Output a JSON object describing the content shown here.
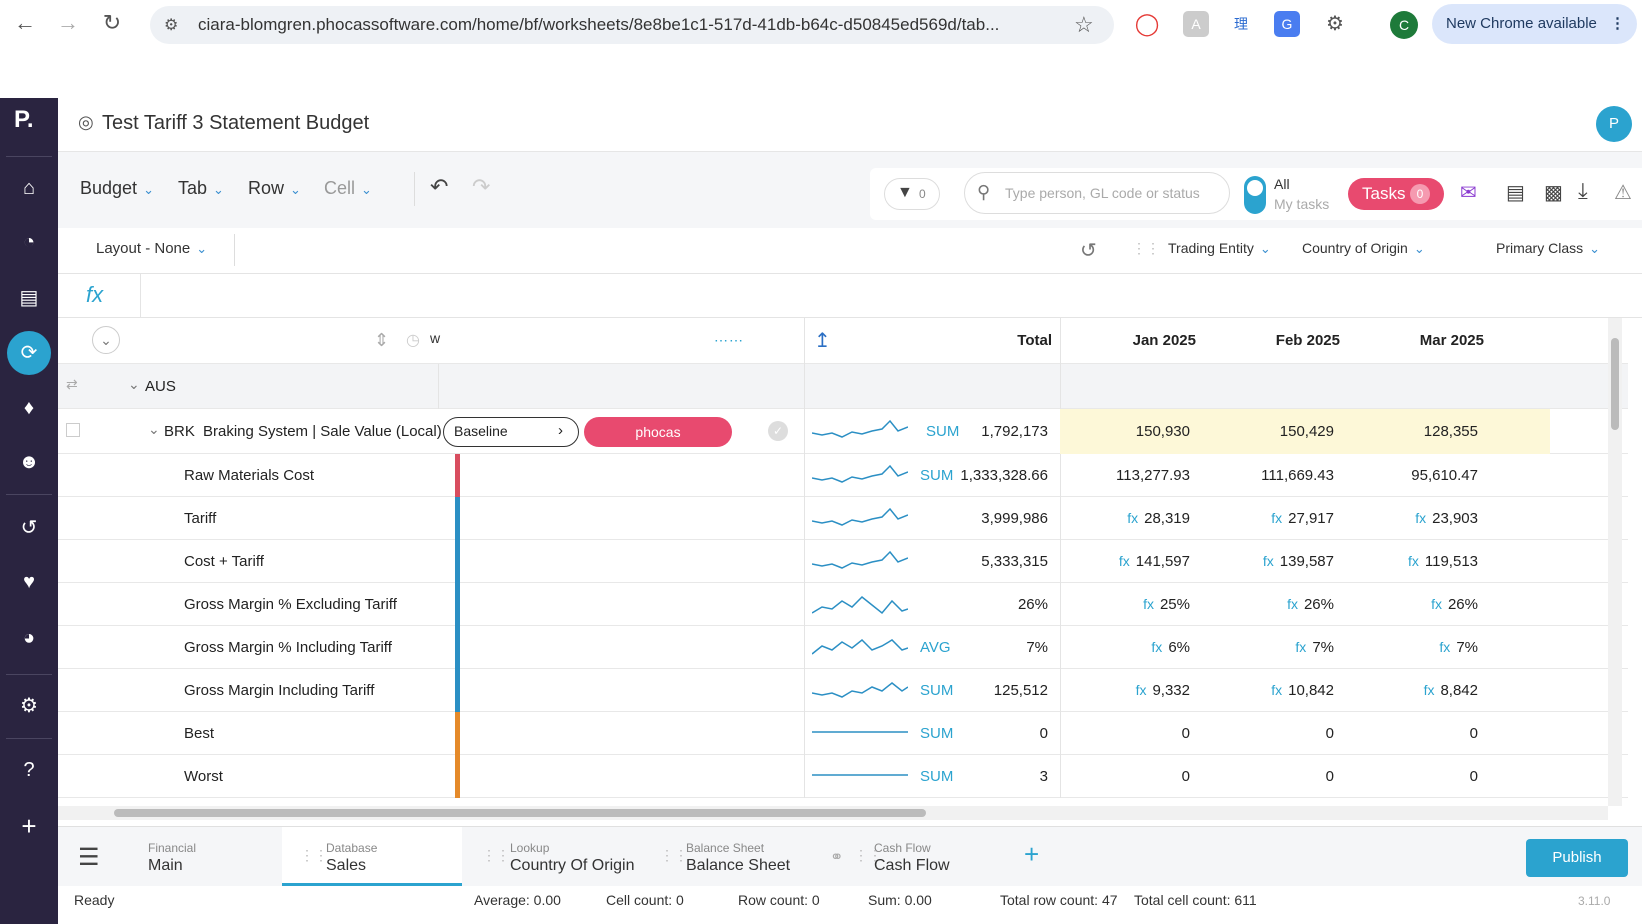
{
  "browser": {
    "url": "ciara-blomgren.phocassoftware.com/home/bf/worksheets/8e8be1c1-517d-41db-b64c-d50845ed569d/tab...",
    "new_chrome": "New Chrome available",
    "avatar_letter": "C"
  },
  "app": {
    "logo": "P.",
    "title": "Test Tariff 3 Statement Budget",
    "user_initial": "P"
  },
  "toolbar": {
    "menus": [
      "Budget",
      "Tab",
      "Row",
      "Cell"
    ],
    "filter_count": "0",
    "search_placeholder": "Type person, GL code or status",
    "all_label": "All",
    "my_tasks_label": "My tasks",
    "tasks_label": "Tasks",
    "tasks_count": "0"
  },
  "layout_bar": {
    "layout_label": "Layout - None",
    "dimensions": [
      "Trading Entity",
      "Country of Origin",
      "Primary Class"
    ]
  },
  "fx_label": "fx",
  "grid": {
    "header": {
      "col_total": "Total",
      "months": [
        "Jan 2025",
        "Feb 2025",
        "Mar 2025"
      ],
      "w": "w"
    },
    "group_label": "AUS",
    "main_row": {
      "code": "BRK",
      "label": "Braking System | Sale Value (Local)",
      "baseline": "Baseline",
      "tag": "phocas",
      "agg": "SUM",
      "total": "1,792,173",
      "months": [
        "150,930",
        "150,429",
        "128,355"
      ]
    },
    "rows": [
      {
        "label": "Raw Materials Cost",
        "agg": "SUM",
        "total": "1,333,328.66",
        "months": [
          "113,277.93",
          "111,669.43",
          "95,610.47"
        ],
        "fx": false
      },
      {
        "label": "Tariff",
        "agg": "",
        "total": "3,999,986",
        "months": [
          "28,319",
          "27,917",
          "23,903"
        ],
        "fx": true
      },
      {
        "label": "Cost + Tariff",
        "agg": "",
        "total": "5,333,315",
        "months": [
          "141,597",
          "139,587",
          "119,513"
        ],
        "fx": true
      },
      {
        "label": "Gross Margin % Excluding Tariff",
        "agg": "",
        "total": "26%",
        "months": [
          "25%",
          "26%",
          "26%"
        ],
        "fx": true
      },
      {
        "label": "Gross Margin % Including Tariff",
        "agg": "AVG",
        "total": "7%",
        "months": [
          "6%",
          "7%",
          "7%"
        ],
        "fx": true
      },
      {
        "label": "Gross Margin Including Tariff",
        "agg": "SUM",
        "total": "125,512",
        "months": [
          "9,332",
          "10,842",
          "8,842"
        ],
        "fx": true
      },
      {
        "label": "Best",
        "agg": "SUM",
        "total": "0",
        "months": [
          "0",
          "0",
          "0"
        ],
        "fx": false
      },
      {
        "label": "Worst",
        "agg": "SUM",
        "total": "3",
        "months": [
          "0",
          "0",
          "0"
        ],
        "fx": false
      }
    ],
    "fx_glyph": "fx"
  },
  "bottom_tabs": [
    {
      "small": "Financial",
      "big": "Main"
    },
    {
      "small": "Database",
      "big": "Sales"
    },
    {
      "small": "Lookup",
      "big": "Country Of Origin"
    },
    {
      "small": "Balance Sheet",
      "big": "Balance Sheet"
    },
    {
      "small": "Cash Flow",
      "big": "Cash Flow"
    }
  ],
  "publish_label": "Publish",
  "status": {
    "ready": "Ready",
    "average": "Average: 0.00",
    "cell_count": "Cell count: 0",
    "row_count": "Row count: 0",
    "sum": "Sum: 0.00",
    "total_rows": "Total row count: 47",
    "total_cells": "Total cell count: 611",
    "version": "3.11.0"
  },
  "colors": {
    "sidebar": "#2a2440",
    "accent": "#2ba3cf",
    "tasks_pink": "#e84a6f",
    "highlight_row": "#fdf8d8",
    "bar_red": "#d84d5f",
    "bar_blue": "#2b8fc4",
    "bar_orange": "#e58a2a"
  }
}
